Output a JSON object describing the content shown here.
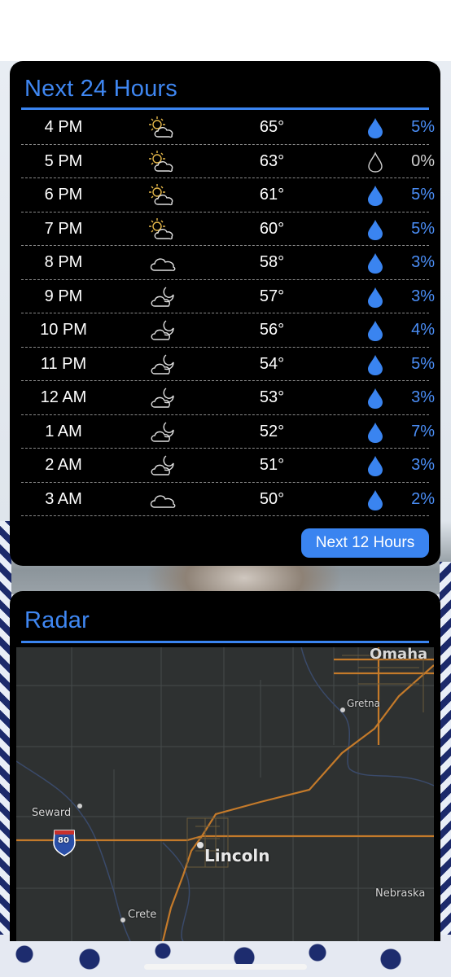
{
  "forecast": {
    "title": "Next 24 Hours",
    "button_label": "Next 12 Hours",
    "accent_color": "#3a84f0",
    "rows": [
      {
        "time": "4 PM",
        "icon": "partly-sunny-icon",
        "temp": "65°",
        "pct": "5%",
        "drop": "filled"
      },
      {
        "time": "5 PM",
        "icon": "partly-sunny-icon",
        "temp": "63°",
        "pct": "0%",
        "drop": "outline"
      },
      {
        "time": "6 PM",
        "icon": "partly-sunny-icon",
        "temp": "61°",
        "pct": "5%",
        "drop": "filled"
      },
      {
        "time": "7 PM",
        "icon": "partly-sunny-icon",
        "temp": "60°",
        "pct": "5%",
        "drop": "filled"
      },
      {
        "time": "8 PM",
        "icon": "cloud-icon",
        "temp": "58°",
        "pct": "3%",
        "drop": "filled"
      },
      {
        "time": "9 PM",
        "icon": "partly-cloudy-night-icon",
        "temp": "57°",
        "pct": "3%",
        "drop": "filled"
      },
      {
        "time": "10 PM",
        "icon": "partly-cloudy-night-icon",
        "temp": "56°",
        "pct": "4%",
        "drop": "filled"
      },
      {
        "time": "11 PM",
        "icon": "partly-cloudy-night-icon",
        "temp": "54°",
        "pct": "5%",
        "drop": "filled"
      },
      {
        "time": "12 AM",
        "icon": "partly-cloudy-night-icon",
        "temp": "53°",
        "pct": "3%",
        "drop": "filled"
      },
      {
        "time": "1 AM",
        "icon": "partly-cloudy-night-icon",
        "temp": "52°",
        "pct": "7%",
        "drop": "filled"
      },
      {
        "time": "2 AM",
        "icon": "partly-cloudy-night-icon",
        "temp": "51°",
        "pct": "3%",
        "drop": "filled"
      },
      {
        "time": "3 AM",
        "icon": "cloud-icon",
        "temp": "50°",
        "pct": "2%",
        "drop": "filled"
      }
    ]
  },
  "radar": {
    "title": "Radar",
    "map_labels": {
      "omaha": "Omaha",
      "gretna": "Gretna",
      "seward": "Seward",
      "lincoln": "Lincoln",
      "nebraska": "Nebraska",
      "crete": "Crete",
      "interstate": "80"
    }
  }
}
